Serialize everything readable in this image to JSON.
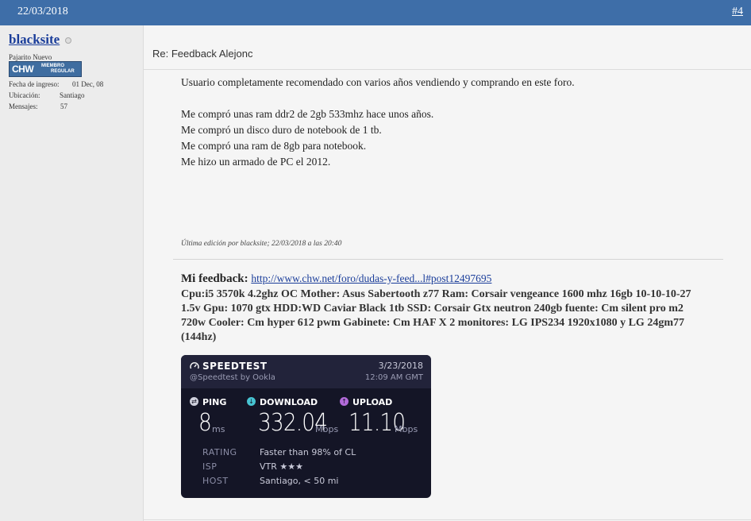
{
  "post": {
    "date": "22/03/2018",
    "number": "#4",
    "title": "Re: Feedback Alejonc",
    "body_lines": [
      "Usuario completamente recomendado con varios años vendiendo y comprando en este foro.",
      "",
      "Me compró unas ram ddr2 de 2gb 533mhz hace unos años.",
      "Me compró un disco duro de notebook de 1 tb.",
      "Me compró una ram de 8gb para notebook.",
      "Me hizo un armado de PC el 2012."
    ],
    "edited_note": "Última edición por blacksite; 22/03/2018 a las 20:40"
  },
  "user": {
    "name": "blacksite",
    "title": "Pajarito Nuevo",
    "badge": {
      "logo": "CHW",
      "line1": "MIEMBRO",
      "line2": "REGULAR"
    },
    "stats": [
      {
        "label": "Fecha de ingreso:",
        "value": "01 Dec, 08"
      },
      {
        "label": "Ubicación:",
        "value": "Santiago"
      },
      {
        "label": "Mensajes:",
        "value": "57"
      }
    ]
  },
  "signature": {
    "heading": "Mi feedback:",
    "link": "http://www.chw.net/foro/dudas-y-feed...l#post12497695",
    "text": "Cpu:i5 3570k 4.2ghz OC Mother: Asus Sabertooth z77 Ram: Corsair vengeance 1600 mhz 16gb 10-10-10-27 1.5v Gpu: 1070 gtx HDD:WD Caviar Black 1tb SSD: Corsair Gtx neutron 240gb fuente: Cm silent pro m2 720w Cooler: Cm hyper 612 pwm Gabinete: Cm HAF X 2 monitores: LG IPS234 1920x1080 y LG 24gm77 (144hz)"
  },
  "speedtest": {
    "brand": "SPEEDTEST",
    "byline": "@Speedtest by Ookla",
    "date": "3/23/2018",
    "time": "12:09 AM GMT",
    "ping": {
      "label": "PING",
      "value": "8",
      "unit": "ms"
    },
    "download": {
      "label": "DOWNLOAD",
      "value": "332.04",
      "unit": "Mbps"
    },
    "upload": {
      "label": "UPLOAD",
      "value": "11.10",
      "unit": "Mbps"
    },
    "details": [
      {
        "key": "RATING",
        "value": "Faster than 98% of CL"
      },
      {
        "key": "ISP",
        "value": "VTR ★★★"
      },
      {
        "key": "HOST",
        "value": "Santiago, < 50 mi"
      }
    ],
    "colors": {
      "background": "#141526",
      "download_icon": "#47c4d2",
      "upload_icon": "#b26bd9",
      "ping_icon": "#cfd0dc"
    }
  }
}
